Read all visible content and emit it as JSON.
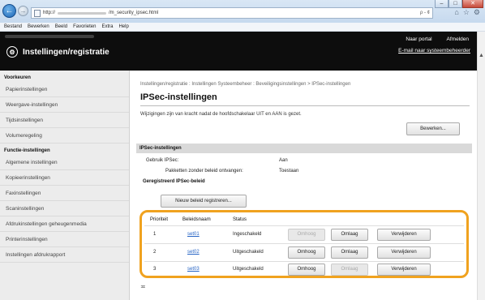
{
  "browser": {
    "address": "http://",
    "address_suffix": "/m_security_ipsec.html",
    "address_right": "ρ - ¢",
    "menu": [
      "Bestand",
      "Bewerken",
      "Beeld",
      "Favorieten",
      "Extra",
      "Help"
    ]
  },
  "header": {
    "links": [
      "Naar portal",
      "Afmelden"
    ],
    "email": "E-mail naar systeembeheerder",
    "title": "Instellingen/registratie"
  },
  "sidebar": {
    "section1": "Voorkeuren",
    "items1": [
      "Papierinstellingen",
      "Weergave-instellingen",
      "Tijdsinstellingen",
      "Volumeregeling"
    ],
    "section2": "Functie-instellingen",
    "items2": [
      "Algemene instellingen",
      "Kopieerinstellingen",
      "Faxinstellingen",
      "Scaninstellingen",
      "Afdrukinstellingen geheugenmedia",
      "Printerinstellingen",
      "Instellingen afdrukrapport"
    ]
  },
  "main": {
    "breadcrumb": "Instellingen/registratie : Instellingen Systeembeheer : Beveiligingsinstellingen > IPSec-instellingen",
    "title": "IPSec-instellingen",
    "note": "Wijzigingen zijn van kracht nadat de hoofdschakelaar UIT en AAN is gezet.",
    "edit_button": "Bewerken...",
    "section_ipsec": "IPSec-instellingen",
    "use_label": "Gebruik IPSec:",
    "use_value": "Aan",
    "accept_label": "Pakketten zonder beleid ontvangen:",
    "accept_value": "Toestaan",
    "section_policy": "Geregistreerd IPSec-beleid",
    "new_policy_button": "Nieuw beleid registreren...",
    "table": {
      "headers": [
        "Prioriteit",
        "Beleidsnaam",
        "Status"
      ],
      "rows": [
        {
          "priority": "1",
          "name": "set01",
          "status": "Ingeschakeld",
          "up": "Omhoog",
          "down": "Omlaag",
          "remove": "Verwijderen"
        },
        {
          "priority": "2",
          "name": "set02",
          "status": "Uitgeschakeld",
          "up": "Omhoog",
          "down": "Omlaag",
          "remove": "Verwijderen"
        },
        {
          "priority": "3",
          "name": "set03",
          "status": "Uitgeschakeld",
          "up": "Omhoog",
          "down": "Omlaag",
          "remove": "Verwijderen"
        }
      ]
    },
    "tail": "≖"
  },
  "colors": {
    "highlight": "#f0a21f",
    "header_bg": "#0d0d0d",
    "link": "#2563c4"
  }
}
